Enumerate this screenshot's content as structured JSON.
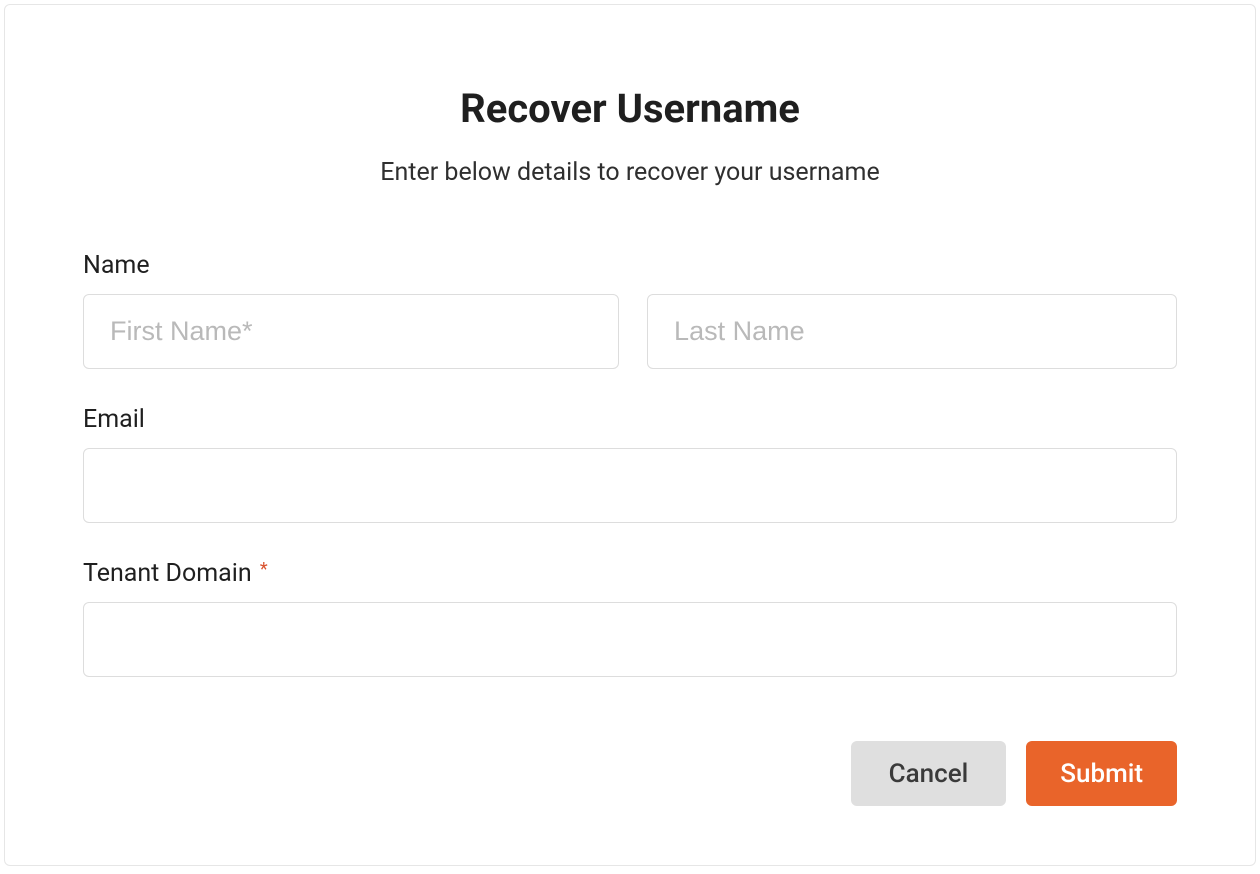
{
  "title": "Recover Username",
  "subtitle": "Enter below details to recover your username",
  "labels": {
    "name": "Name",
    "email": "Email",
    "tenant_domain": "Tenant Domain",
    "required_mark": "*"
  },
  "fields": {
    "first_name": {
      "value": "",
      "placeholder": "First Name*"
    },
    "last_name": {
      "value": "",
      "placeholder": "Last Name"
    },
    "email": {
      "value": "",
      "placeholder": ""
    },
    "tenant_domain": {
      "value": "",
      "placeholder": ""
    }
  },
  "actions": {
    "cancel_label": "Cancel",
    "submit_label": "Submit"
  },
  "colors": {
    "accent": "#e9642a",
    "border": "#dddddd",
    "text": "#1f1f1f",
    "muted_button": "#dfdfdf",
    "required": "#d9532f"
  }
}
